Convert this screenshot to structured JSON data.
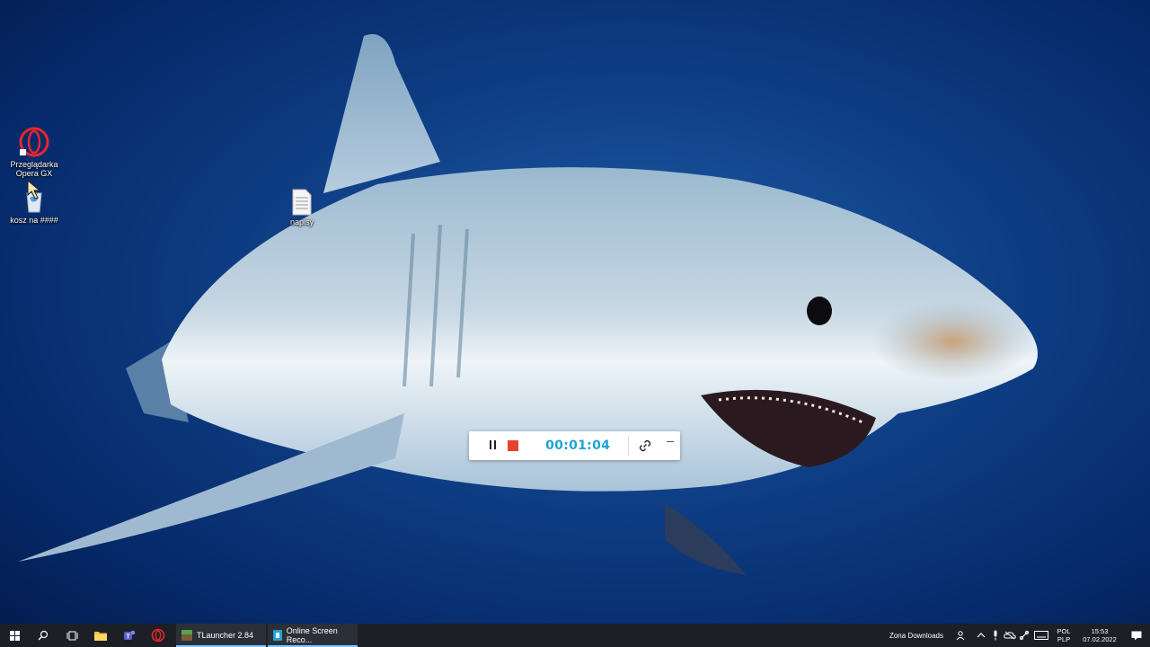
{
  "desktop": {
    "icons": [
      {
        "label": "Przeglądarka Opera GX",
        "icon": "opera-gx-icon"
      },
      {
        "label": "kosz na ####",
        "icon": "recycle-bin-icon"
      },
      {
        "label": "napisy",
        "icon": "text-file-icon"
      }
    ],
    "wallpaper": "great-white-shark-underwater"
  },
  "recorder": {
    "timer": "00:01:04",
    "pause_icon": "pause-icon",
    "stop_icon": "stop-icon",
    "link_icon": "link-icon",
    "minimize_icon": "minimize-icon",
    "timer_color": "#1fa3d8",
    "stop_color": "#e8432a"
  },
  "taskbar": {
    "start_icon": "windows-start-icon",
    "pinned": [
      "search-icon",
      "task-view-icon",
      "file-explorer-icon",
      "teams-icon",
      "opera-gx-icon"
    ],
    "apps": [
      {
        "label": "TLauncher 2.84",
        "icon": "tlauncher-icon"
      },
      {
        "label": "Online Screen Reco...",
        "icon": "screen-recorder-icon"
      }
    ],
    "tray": {
      "toolbar_label": "Zona Downloads",
      "language_top": "POL",
      "language_bottom": "PLP",
      "time": "15:53",
      "date": "07.02.2022"
    }
  }
}
